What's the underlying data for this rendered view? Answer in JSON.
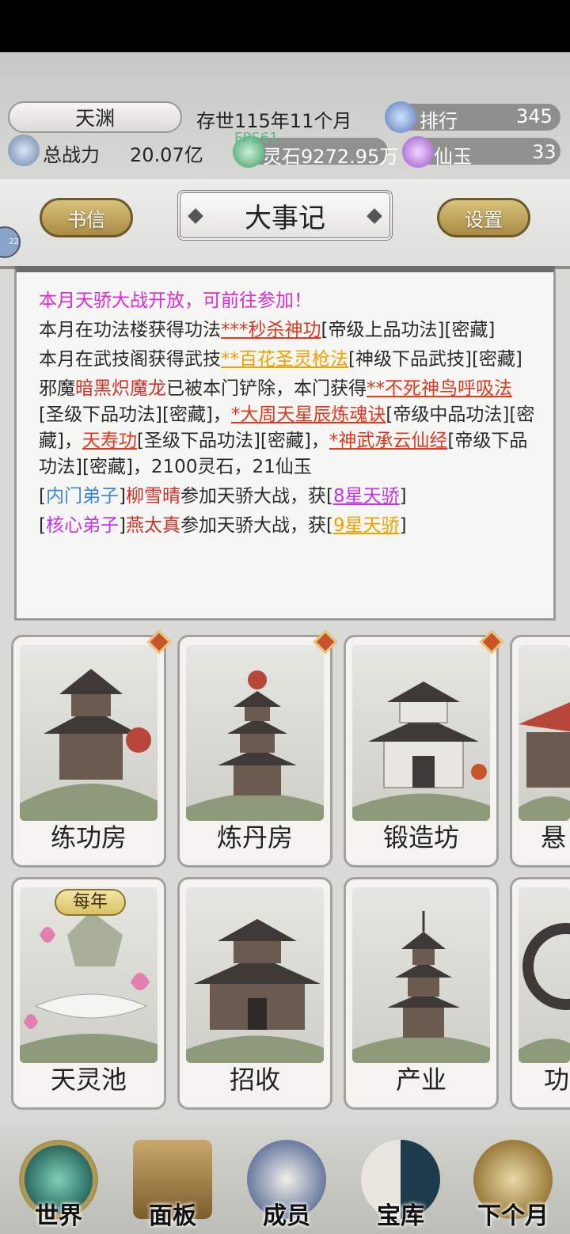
{
  "header": {
    "sect_name": "天渊",
    "era": "存世115年11个月",
    "rank_label": "排行",
    "rank_value": "345",
    "power_label": "总战力",
    "power_value": "20.07亿",
    "fps": "FPS61",
    "spirit_stone": "灵石9272.95万",
    "jade_label": "仙玉",
    "jade_value": "33"
  },
  "menu": {
    "letters": "书信",
    "title": "大事记",
    "settings": "设置",
    "side_chip": "22"
  },
  "log": {
    "line1": "本月天骄大战开放，可前往参加！",
    "e2": {
      "a": "本月在功法楼获得功法",
      "b": "***秒杀神功",
      "c": "[帝级上品功法][密藏]"
    },
    "e3": {
      "a": "本月在武技阁获得武技",
      "b": "**百花圣灵枪法",
      "c": "[神级下品武技][密藏]"
    },
    "e4": {
      "a": "邪魔",
      "b": "暗黑炽魔龙",
      "c": "已被本门铲除，本门获得",
      "d": "**不死神鸟呼吸法",
      "e": "[圣级下品功法][密藏]，",
      "f": "*大周天星辰炼魂诀",
      "g": "[帝级中品功法][密藏]，",
      "h": "天寿功",
      "i": "[圣级下品功法][密藏]，",
      "j": "*神武承云仙经",
      "k": "[帝级下品功法][密藏]，2100灵石，21仙玉"
    },
    "e5": {
      "a": "[",
      "b": "内门弟子",
      "c": "]",
      "d": "柳雪晴",
      "e": "参加天骄大战，获[",
      "f": "8星天骄",
      "g": "]"
    },
    "e6": {
      "a": "[",
      "b": "核心弟子",
      "c": "]",
      "d": "燕太真",
      "e": "参加天骄大战，获[",
      "f": "9星天骄",
      "g": "]"
    }
  },
  "buildings": {
    "row1": [
      "练功房",
      "炼丹房",
      "锻造坊",
      "悬"
    ],
    "row2": [
      "天灵池",
      "招收",
      "产业",
      "功"
    ],
    "yearly_badge": "每年"
  },
  "nav": {
    "world": "世界",
    "panel": "面板",
    "members": "成员",
    "treasury": "宝库",
    "next_month": "下个月"
  },
  "colors": {
    "accent_gold": "#b8994f",
    "highlight_pink": "#d62cd2",
    "item_red": "#d93a22",
    "item_orange": "#f0a000",
    "rank_blue": "#3a86d9"
  }
}
